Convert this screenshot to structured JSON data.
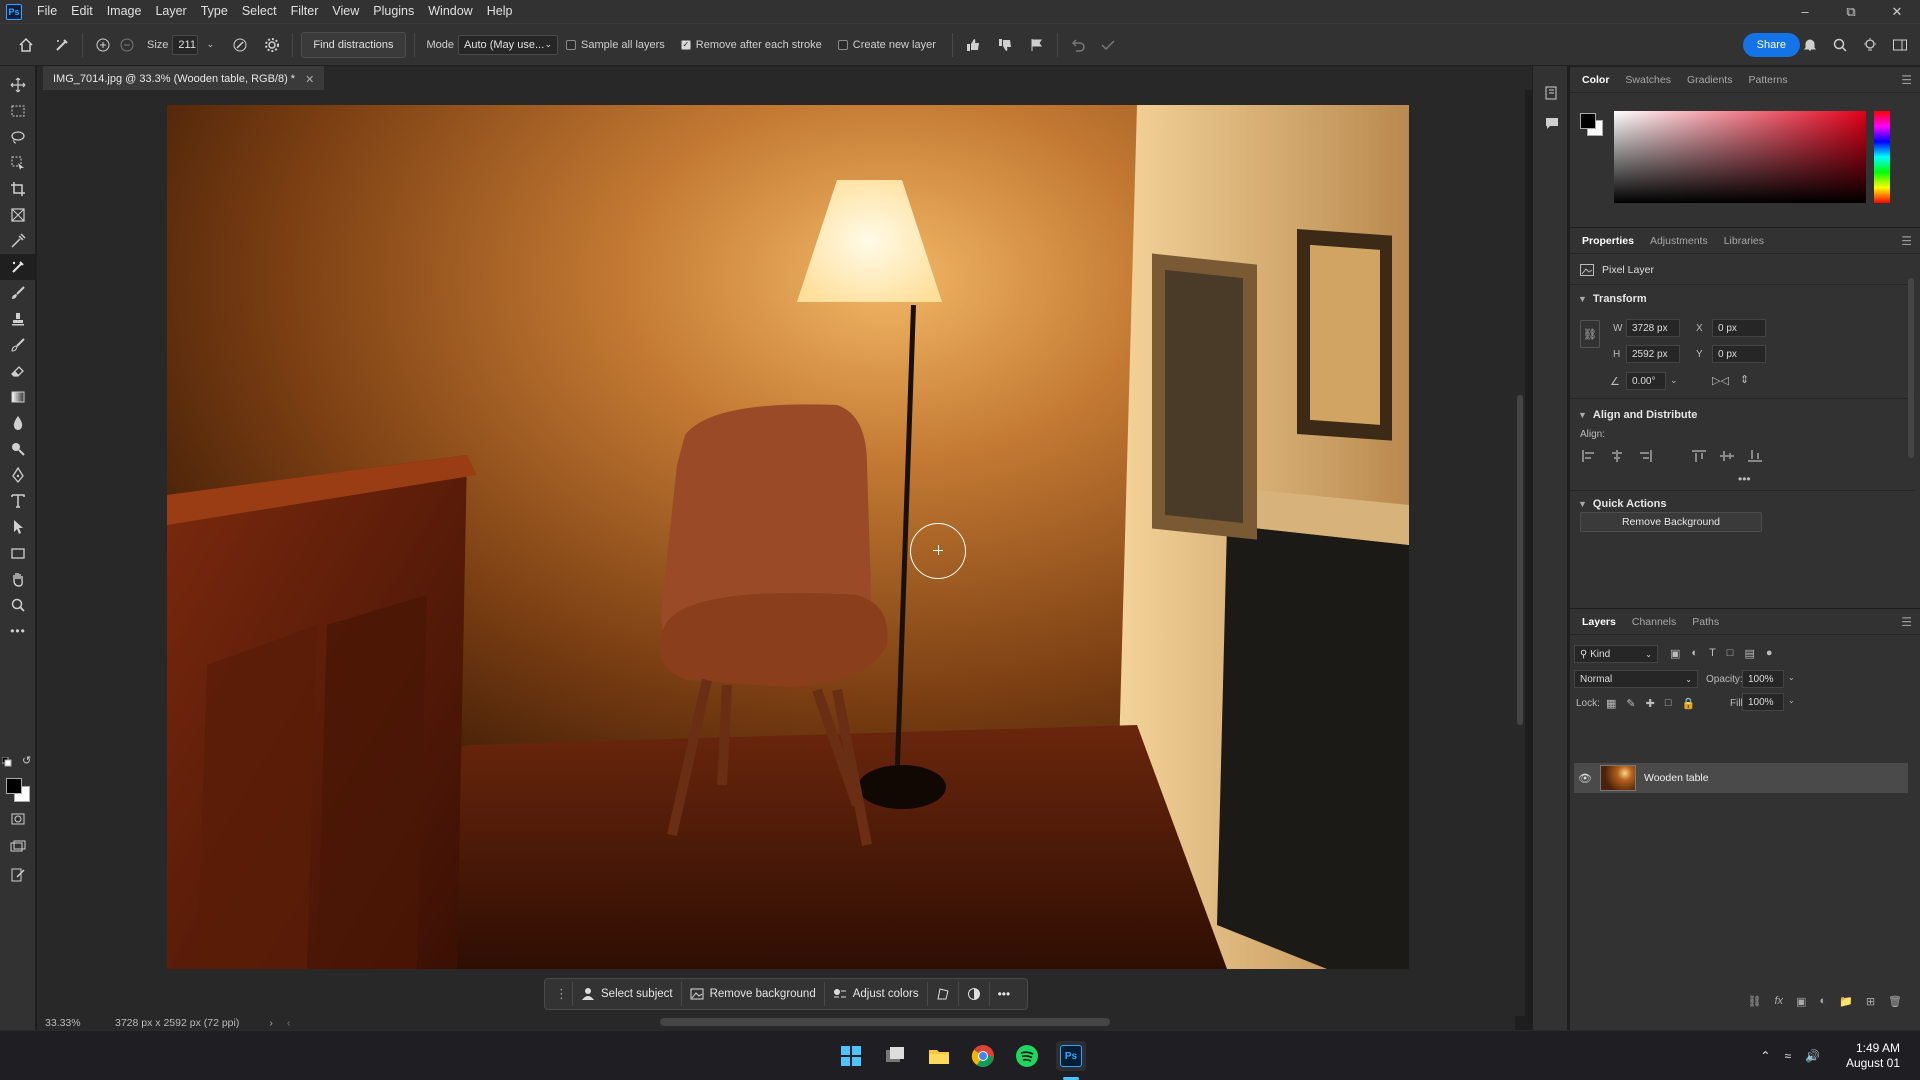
{
  "menubar": {
    "logo": "Ps",
    "items": [
      "File",
      "Edit",
      "Image",
      "Layer",
      "Type",
      "Select",
      "Filter",
      "View",
      "Plugins",
      "Window",
      "Help"
    ]
  },
  "options": {
    "size_label": "Size",
    "size_value": "211",
    "find_distractions": "Find distractions",
    "mode_label": "Mode",
    "mode_value": "Auto (May use...",
    "sample_all_layers": "Sample all layers",
    "remove_after_stroke": "Remove after each stroke",
    "create_new_layer": "Create new layer",
    "share": "Share"
  },
  "document": {
    "tab_title": "IMG_7014.jpg @ 33.3% (Wooden table, RGB/8) *",
    "zoom": "33.33%",
    "doc_info": "3728 px x 2592 px (72 ppi)"
  },
  "context_bar": {
    "select_subject": "Select subject",
    "remove_background": "Remove background",
    "adjust_colors": "Adjust colors"
  },
  "color_panel": {
    "tabs": [
      "Color",
      "Swatches",
      "Gradients",
      "Patterns"
    ]
  },
  "properties": {
    "tabs": [
      "Properties",
      "Adjustments",
      "Libraries"
    ],
    "layer_type": "Pixel Layer",
    "transform_title": "Transform",
    "w_label": "W",
    "w_value": "3728 px",
    "h_label": "H",
    "h_value": "2592 px",
    "x_label": "X",
    "x_value": "0 px",
    "y_label": "Y",
    "y_value": "0 px",
    "angle_value": "0.00°",
    "align_title": "Align and Distribute",
    "align_label": "Align:",
    "quick_actions_title": "Quick Actions",
    "remove_bg_btn": "Remove Background"
  },
  "layers": {
    "tabs": [
      "Layers",
      "Channels",
      "Paths"
    ],
    "kind": "Kind",
    "blend_mode": "Normal",
    "opacity_label": "Opacity:",
    "opacity_value": "100%",
    "lock_label": "Lock:",
    "fill_label": "Fill:",
    "fill_value": "100%",
    "layer_name": "Wooden table"
  },
  "taskbar": {
    "time": "1:49 AM",
    "date": "August 01"
  },
  "colors": {
    "accent": "#1473e6",
    "panel_bg": "#323232",
    "canvas_bg": "#282828"
  }
}
